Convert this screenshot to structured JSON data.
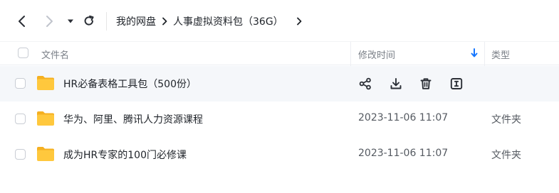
{
  "nav": {
    "breadcrumb": [
      {
        "label": "我的网盘"
      },
      {
        "label": "人事虚拟资料包（36G）"
      }
    ]
  },
  "table": {
    "columns": {
      "name": "文件名",
      "modified": "修改时间",
      "type": "类型"
    },
    "rows": [
      {
        "name": "HR必备表格工具包（500份）",
        "modified": "",
        "type": "",
        "hovered": true
      },
      {
        "name": "华为、阿里、腾讯人力资源课程",
        "modified": "2023-11-06 11:07",
        "type": "文件夹"
      },
      {
        "name": "成为HR专家的100门必修课",
        "modified": "2023-11-06 11:07",
        "type": "文件夹"
      }
    ]
  },
  "colors": {
    "accent": "#1677ff",
    "folder": "#ffc83d",
    "folder_back": "#f5b021"
  }
}
